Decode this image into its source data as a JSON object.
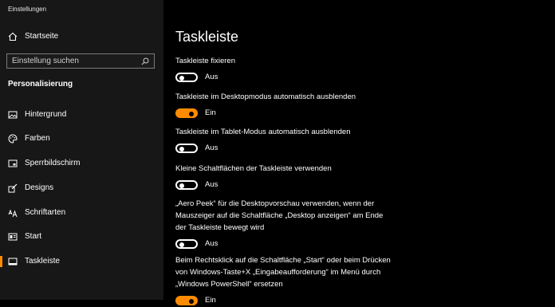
{
  "window_title": "Einstellungen",
  "sidebar": {
    "home_label": "Startseite",
    "search_placeholder": "Einstellung suchen",
    "section_title": "Personalisierung",
    "items": [
      {
        "label": "Hintergrund",
        "icon": "image-icon"
      },
      {
        "label": "Farben",
        "icon": "palette-icon"
      },
      {
        "label": "Sperrbildschirm",
        "icon": "lock-screen-icon"
      },
      {
        "label": "Designs",
        "icon": "brush-icon"
      },
      {
        "label": "Schriftarten",
        "icon": "font-icon"
      },
      {
        "label": "Start",
        "icon": "start-menu-icon"
      },
      {
        "label": "Taskleiste",
        "icon": "taskbar-icon",
        "active": true
      }
    ]
  },
  "main": {
    "title": "Taskleiste",
    "settings": [
      {
        "label": "Taskleiste fixieren",
        "on": false,
        "state": "Aus"
      },
      {
        "label": "Taskleiste im Desktopmodus automatisch ausblenden",
        "on": true,
        "state": "Ein"
      },
      {
        "label": "Taskleiste im Tablet-Modus automatisch ausblenden",
        "on": false,
        "state": "Aus"
      },
      {
        "label": "Kleine Schaltflächen der Taskleiste verwenden",
        "on": false,
        "state": "Aus"
      },
      {
        "label": "„Aero Peek“ für die Desktopvorschau verwenden, wenn der Mauszeiger auf die Schaltfläche „Desktop anzeigen“ am Ende der Taskleiste bewegt wird",
        "on": false,
        "state": "Aus"
      },
      {
        "label": "Beim Rechtsklick auf die Schaltfläche „Start“ oder beim Drücken von Windows-Taste+X „Eingabeaufforderung“ im Menü durch „Windows PowerShell“ ersetzen",
        "on": true,
        "state": "Ein"
      }
    ]
  },
  "colors": {
    "accent": "#ff8c00",
    "sidebar_bg": "#171717",
    "main_bg": "#000000"
  }
}
